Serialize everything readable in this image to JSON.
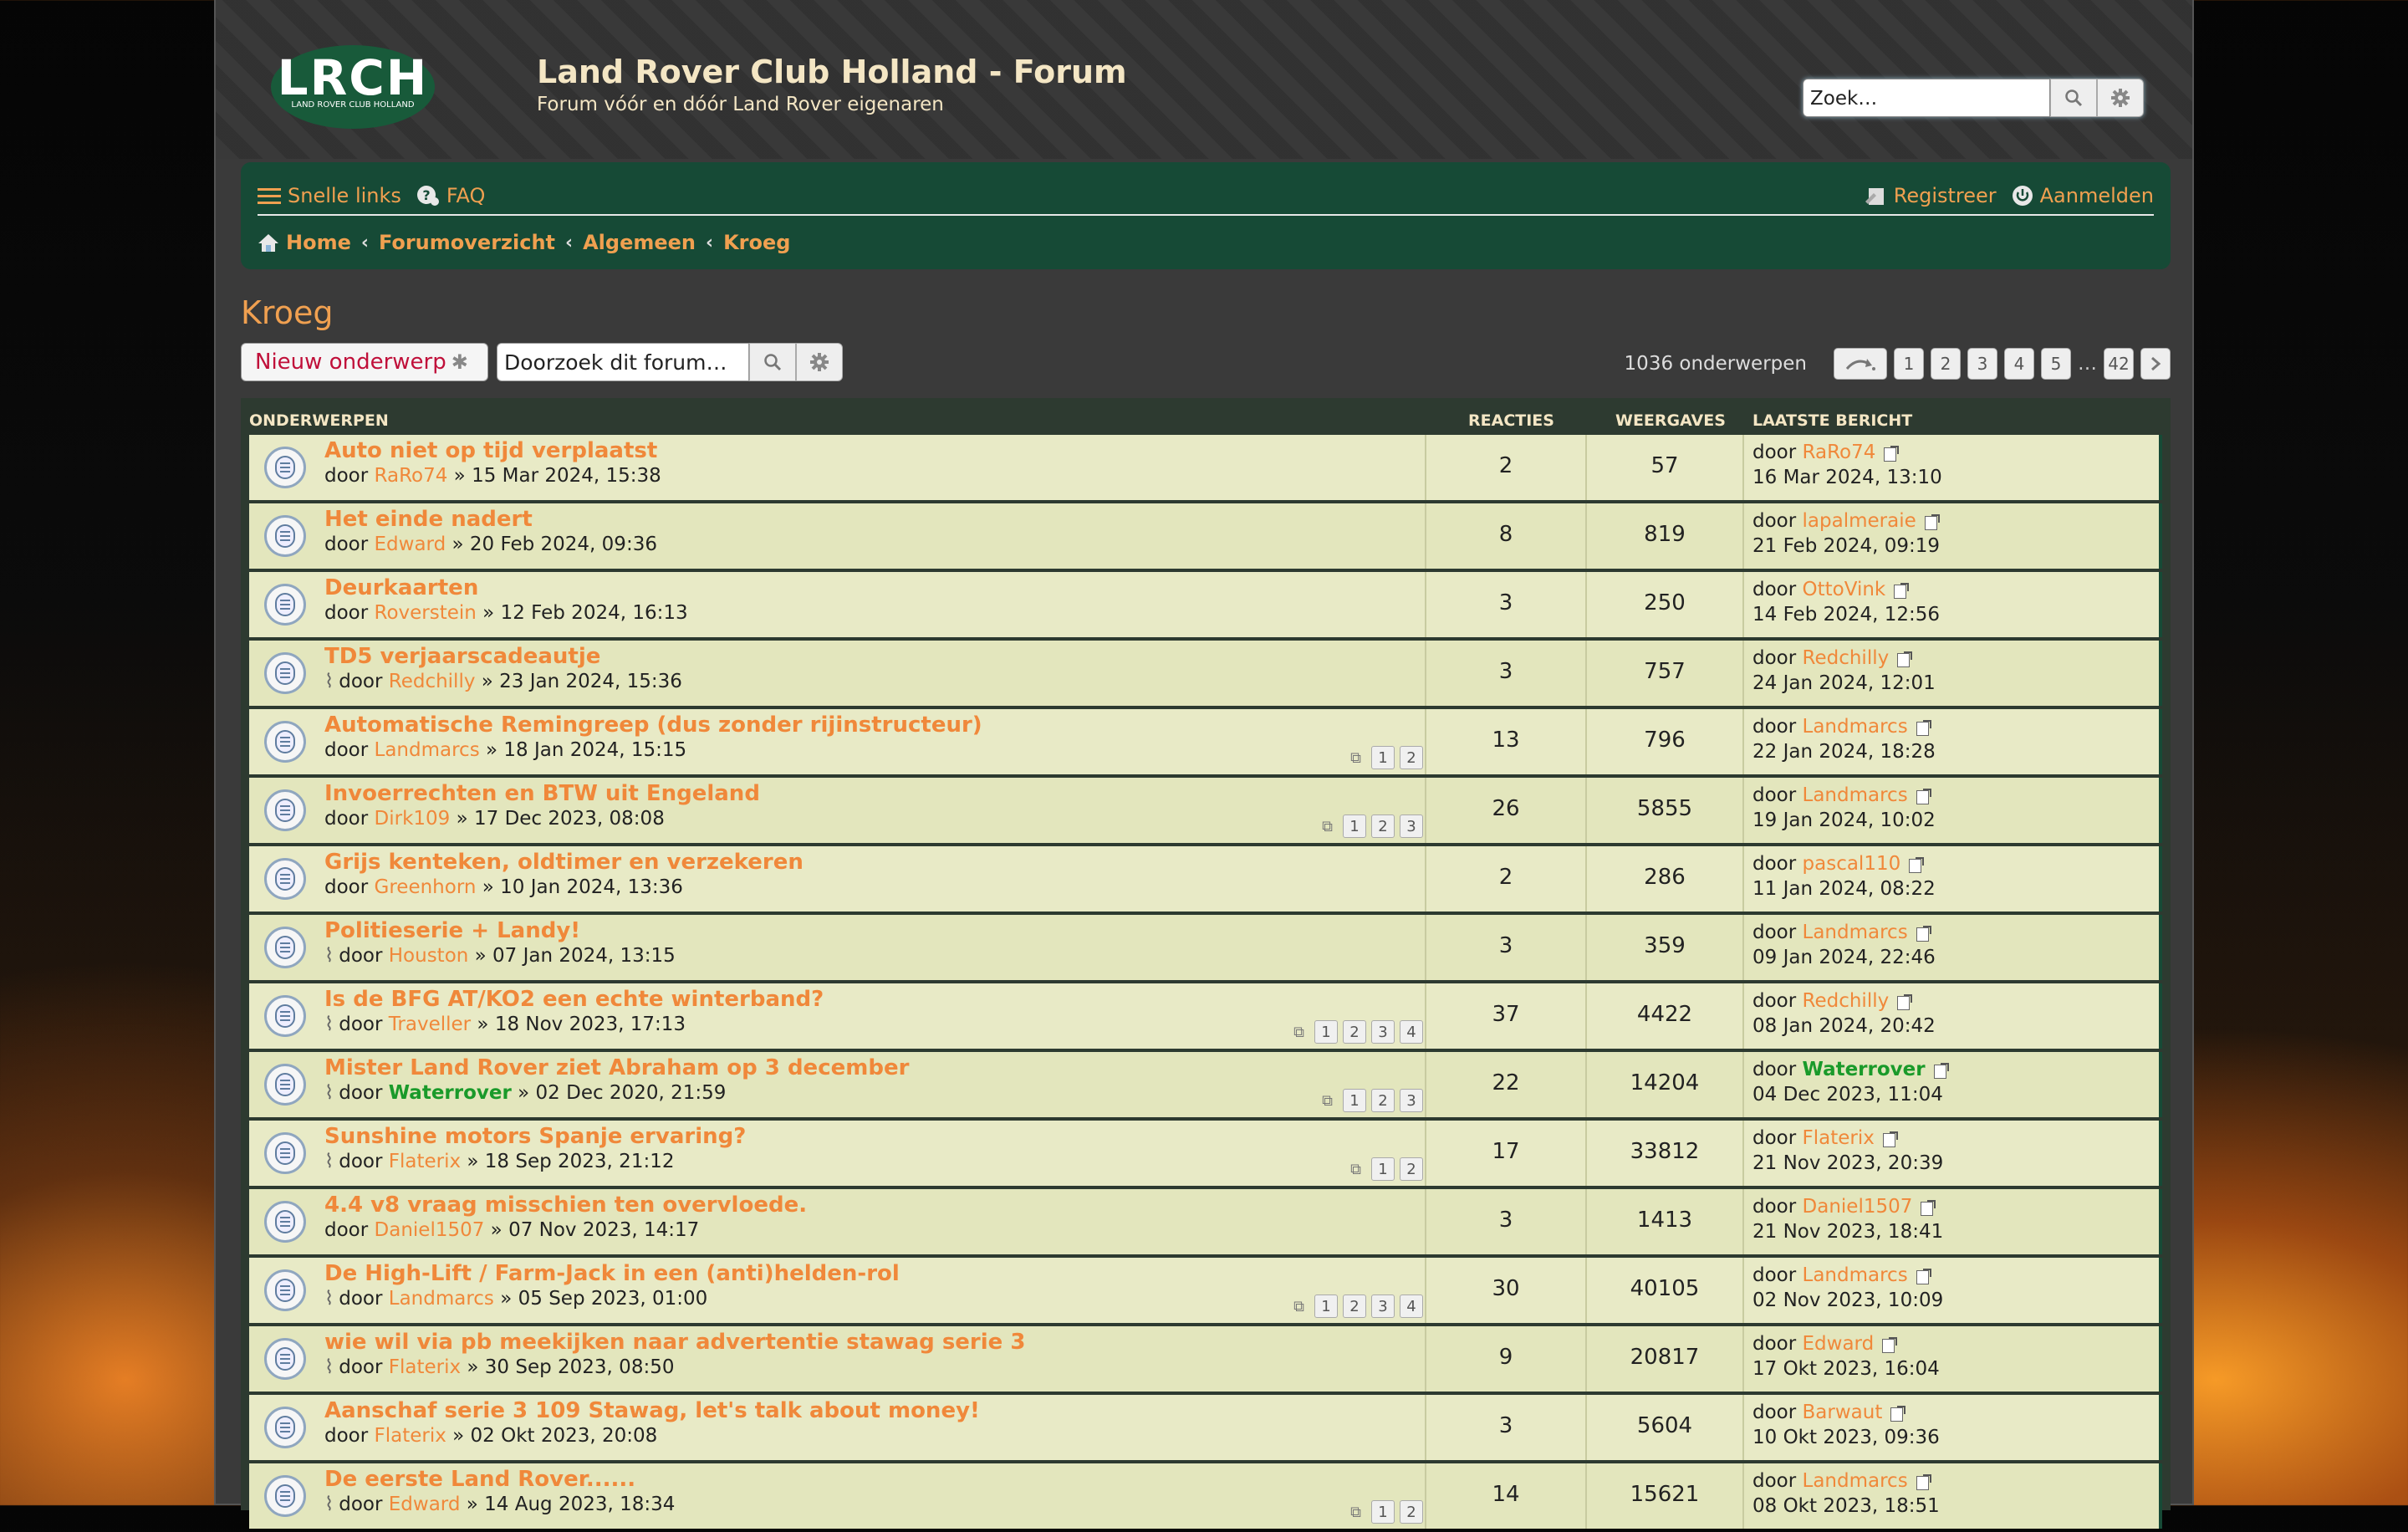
{
  "site": {
    "logo_text": "LRCH",
    "logo_sub": "LAND ROVER CLUB HOLLAND",
    "title": "Land Rover Club Holland - Forum",
    "description": "Forum vóór en dóór Land Rover eigenaren",
    "search_placeholder": "Zoek…"
  },
  "nav": {
    "quick_links": "Snelle links",
    "faq": "FAQ",
    "register": "Registreer",
    "login": "Aanmelden",
    "breadcrumbs": [
      "Home",
      "Forumoverzicht",
      "Algemeen",
      "Kroeg"
    ]
  },
  "forum": {
    "title": "Kroeg",
    "new_topic": "Nieuw onderwerp",
    "search_placeholder": "Doorzoek dit forum…",
    "topic_count": "1036 onderwerpen",
    "pages": [
      "1",
      "2",
      "3",
      "4",
      "5",
      "…",
      "42"
    ]
  },
  "table": {
    "col_topics": "ONDERWERPEN",
    "col_replies": "REACTIES",
    "col_views": "WEERGAVES",
    "col_last": "LAATSTE BERICHT",
    "by": "door",
    "topics": [
      {
        "title": "Auto niet op tijd verplaatst",
        "author": "RaRo74",
        "date": "» 15 Mar 2024, 15:38",
        "attach": false,
        "pages": [],
        "replies": "2",
        "views": "57",
        "last_user": "RaRo74",
        "last_date": "16 Mar 2024, 13:10"
      },
      {
        "title": "Het einde nadert",
        "author": "Edward",
        "date": "» 20 Feb 2024, 09:36",
        "attach": false,
        "pages": [],
        "replies": "8",
        "views": "819",
        "last_user": "lapalmeraie",
        "last_date": "21 Feb 2024, 09:19"
      },
      {
        "title": "Deurkaarten",
        "author": "Roverstein",
        "date": "» 12 Feb 2024, 16:13",
        "attach": false,
        "pages": [],
        "replies": "3",
        "views": "250",
        "last_user": "OttoVink",
        "last_date": "14 Feb 2024, 12:56"
      },
      {
        "title": "TD5 verjaarscadeautje",
        "author": "Redchilly",
        "date": "» 23 Jan 2024, 15:36",
        "attach": true,
        "pages": [],
        "replies": "3",
        "views": "757",
        "last_user": "Redchilly",
        "last_date": "24 Jan 2024, 12:01"
      },
      {
        "title": "Automatische Remingreep (dus zonder rijinstructeur)",
        "author": "Landmarcs",
        "date": "» 18 Jan 2024, 15:15",
        "attach": false,
        "pages": [
          "1",
          "2"
        ],
        "replies": "13",
        "views": "796",
        "last_user": "Landmarcs",
        "last_date": "22 Jan 2024, 18:28"
      },
      {
        "title": "Invoerrechten en BTW uit Engeland",
        "author": "Dirk109",
        "date": "» 17 Dec 2023, 08:08",
        "attach": false,
        "pages": [
          "1",
          "2",
          "3"
        ],
        "replies": "26",
        "views": "5855",
        "last_user": "Landmarcs",
        "last_date": "19 Jan 2024, 10:02"
      },
      {
        "title": "Grijs kenteken, oldtimer en verzekeren",
        "author": "Greenhorn",
        "date": "» 10 Jan 2024, 13:36",
        "attach": false,
        "pages": [],
        "replies": "2",
        "views": "286",
        "last_user": "pascal110",
        "last_date": "11 Jan 2024, 08:22"
      },
      {
        "title": "Politieserie + Landy!",
        "author": "Houston",
        "date": "» 07 Jan 2024, 13:15",
        "attach": true,
        "pages": [],
        "replies": "3",
        "views": "359",
        "last_user": "Landmarcs",
        "last_date": "09 Jan 2024, 22:46"
      },
      {
        "title": "Is de BFG AT/KO2 een echte winterband?",
        "author": "Traveller",
        "date": "» 18 Nov 2023, 17:13",
        "attach": true,
        "pages": [
          "1",
          "2",
          "3",
          "4"
        ],
        "replies": "37",
        "views": "4422",
        "last_user": "Redchilly",
        "last_date": "08 Jan 2024, 20:42"
      },
      {
        "title": "Mister Land Rover ziet Abraham op 3 december",
        "author": "Waterrover",
        "author_green": true,
        "date": "» 02 Dec 2020, 21:59",
        "attach": true,
        "pages": [
          "1",
          "2",
          "3"
        ],
        "replies": "22",
        "views": "14204",
        "last_user": "Waterrover",
        "last_green": true,
        "last_date": "04 Dec 2023, 11:04"
      },
      {
        "title": "Sunshine motors Spanje ervaring?",
        "author": "Flaterix",
        "date": "» 18 Sep 2023, 21:12",
        "attach": true,
        "pages": [
          "1",
          "2"
        ],
        "replies": "17",
        "views": "33812",
        "last_user": "Flaterix",
        "last_date": "21 Nov 2023, 20:39"
      },
      {
        "title": "4.4 v8 vraag misschien ten overvloede.",
        "author": "Daniel1507",
        "date": "» 07 Nov 2023, 14:17",
        "attach": false,
        "pages": [],
        "replies": "3",
        "views": "1413",
        "last_user": "Daniel1507",
        "last_date": "21 Nov 2023, 18:41"
      },
      {
        "title": "De High-Lift / Farm-Jack in een (anti)helden-rol",
        "author": "Landmarcs",
        "date": "» 05 Sep 2023, 01:00",
        "attach": true,
        "pages": [
          "1",
          "2",
          "3",
          "4"
        ],
        "replies": "30",
        "views": "40105",
        "last_user": "Landmarcs",
        "last_date": "02 Nov 2023, 10:09"
      },
      {
        "title": "wie wil via pb meekijken naar advertentie stawag serie 3",
        "author": "Flaterix",
        "date": "» 30 Sep 2023, 08:50",
        "attach": true,
        "pages": [],
        "replies": "9",
        "views": "20817",
        "last_user": "Edward",
        "last_date": "17 Okt 2023, 16:04"
      },
      {
        "title": "Aanschaf serie 3 109 Stawag, let's talk about money!",
        "author": "Flaterix",
        "date": "» 02 Okt 2023, 20:08",
        "attach": false,
        "pages": [],
        "replies": "3",
        "views": "5604",
        "last_user": "Barwaut",
        "last_date": "10 Okt 2023, 09:36"
      },
      {
        "title": "De eerste Land Rover......",
        "author": "Edward",
        "date": "» 14 Aug 2023, 18:34",
        "attach": true,
        "pages": [
          "1",
          "2"
        ],
        "replies": "14",
        "views": "15621",
        "last_user": "Landmarcs",
        "last_date": "08 Okt 2023, 18:51"
      }
    ]
  }
}
